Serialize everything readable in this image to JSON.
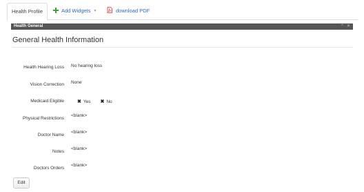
{
  "tabs": {
    "active": "Health Profile",
    "add_widgets": "Add Widgets",
    "download_pdf": "download PDF"
  },
  "panel": {
    "header": "Health General",
    "title": "General Health Information"
  },
  "fields": [
    {
      "label": "Health Hearing Loss",
      "value": "No hearing loss"
    },
    {
      "label": "Vision Correction",
      "value": "None"
    },
    {
      "label": "Medicaid Eligible",
      "options": [
        "Yes",
        "No"
      ]
    },
    {
      "label": "Physical Restrictions",
      "value": "<blank>"
    },
    {
      "label": "Doctor Name",
      "value": "<blank>"
    },
    {
      "label": "Notes",
      "value": "<blank>"
    },
    {
      "label": "Doctors Orders",
      "value": "<blank>"
    }
  ],
  "actions": {
    "edit_label": "Edit"
  },
  "icons": {
    "add": "plus-icon",
    "dropdown": "caret-down-icon",
    "pdf": "pdf-icon",
    "option_mark": "x-icon"
  },
  "colors": {
    "link": "#2a6ab8",
    "header_bg": "#555555",
    "plus": "#3aa33a",
    "pdf": "#d9332a"
  }
}
